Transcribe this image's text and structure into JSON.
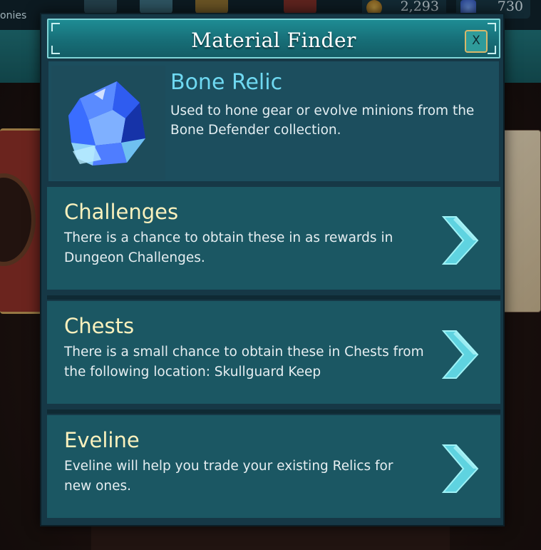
{
  "background": {
    "top_label": "onies",
    "currency": [
      {
        "icon": "coin-icon",
        "value": "2,293"
      },
      {
        "icon": "gem-icon",
        "value": "730"
      }
    ]
  },
  "modal": {
    "title": "Material Finder",
    "close_label": "X",
    "item": {
      "icon": "blue-crystal-relic-icon",
      "name": "Bone Relic",
      "description": "Used to hone gear or evolve minions from the Bone Defender collection."
    },
    "sources": [
      {
        "title": "Challenges",
        "description": "There is a chance to obtain these in as rewards in Dungeon Challenges.",
        "arrow_icon": "chevron-right-icon"
      },
      {
        "title": "Chests",
        "description": "There is a small chance to obtain these in Chests from the following location: Skullguard Keep",
        "arrow_icon": "chevron-right-icon"
      },
      {
        "title": "Eveline",
        "description": "Eveline will help you trade your existing Relics for new ones.",
        "arrow_icon": "chevron-right-icon"
      }
    ]
  },
  "colors": {
    "modal_bg": "#163846",
    "header_teal": "#1e8c94",
    "item_name": "#6fd9f2",
    "source_title": "#fbf1bd",
    "arrow": "#5fd3e0"
  }
}
